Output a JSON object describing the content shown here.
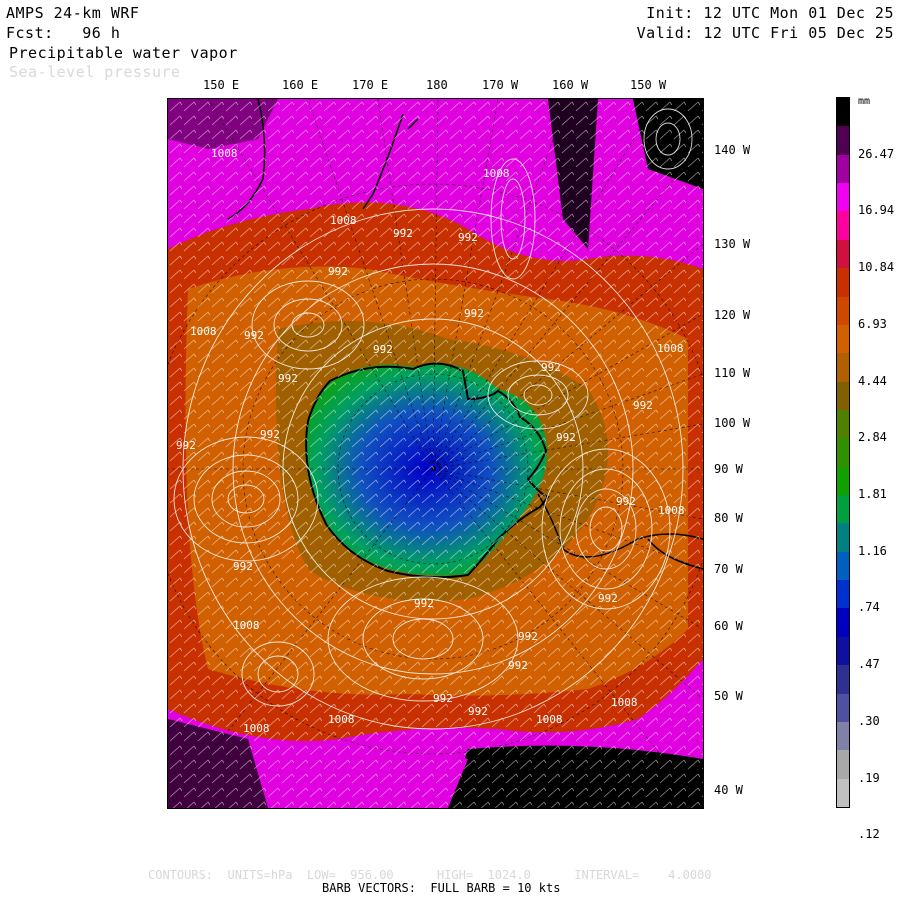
{
  "header": {
    "model": "AMPS 24-km WRF",
    "forecast": "Fcst:   96 h",
    "field_primary": "Precipitable water vapor",
    "field_secondary": "Sea-level pressure",
    "init": "Init: 12 UTC Mon 01 Dec 25",
    "valid": "Valid: 12 UTC Fri 05 Dec 25"
  },
  "map": {
    "projection": "polar stereographic, South Pole",
    "top_labels": [
      "150 E",
      "160 E",
      "170 E",
      "180",
      "170 W",
      "160 W",
      "150 W"
    ],
    "right_labels": [
      "140 W",
      "130 W",
      "120 W",
      "110 W",
      "100 W",
      "90 W",
      "80 W",
      "70 W",
      "60 W",
      "50 W",
      "40 W"
    ],
    "pressure_labels": [
      "1008",
      "992",
      "1008",
      "992",
      "992",
      "1008",
      "992",
      "1008",
      "992",
      "1008",
      "992",
      "992",
      "992",
      "992",
      "992",
      "992",
      "992",
      "992",
      "992",
      "992",
      "992",
      "1008",
      "1008",
      "992",
      "992",
      "1008",
      "1008",
      "992",
      "992",
      "1008",
      "1008"
    ]
  },
  "colorbar": {
    "units": "mm",
    "labels": [
      "26.47",
      "16.94",
      "10.84",
      "6.93",
      "4.44",
      "2.84",
      "1.81",
      "1.16",
      ".74",
      ".47",
      ".30",
      ".19",
      ".12"
    ],
    "colors": [
      "#000000",
      "#500050",
      "#a000a0",
      "#f000f0",
      "#ff00a0",
      "#d01040",
      "#c83000",
      "#d04800",
      "#d06000",
      "#b06000",
      "#806000",
      "#508000",
      "#309000",
      "#10a000",
      "#00a040",
      "#008080",
      "#0060c0",
      "#0030d0",
      "#0000c0",
      "#1010a0",
      "#303090",
      "#5050a0",
      "#8080a8",
      "#a8a8a8",
      "#c0c0c0"
    ]
  },
  "footer": {
    "contours": "CONTOURS:  UNITS=hPa  LOW=  956.00      HIGH=  1024.0      INTERVAL=    4.0000",
    "barbs": "BARB VECTORS:  FULL BARB = 10 kts"
  }
}
